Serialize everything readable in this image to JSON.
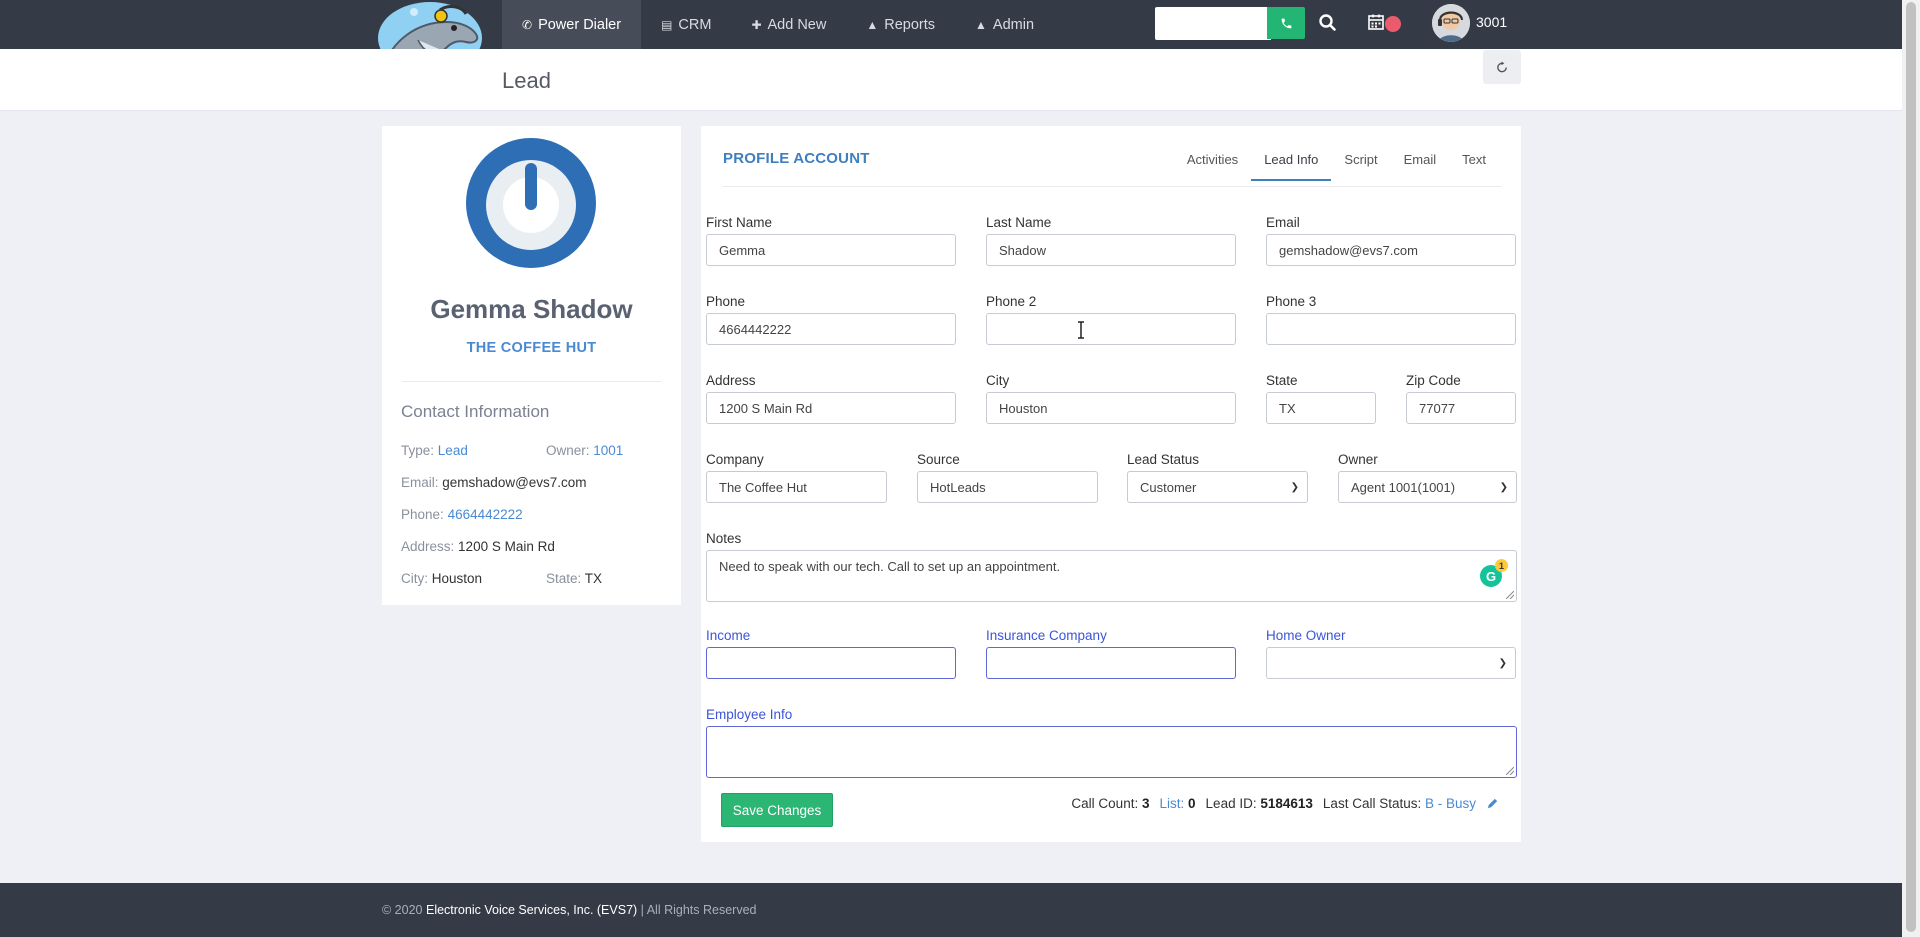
{
  "nav": {
    "items": [
      {
        "label": "Power Dialer",
        "icon": "phone-icon"
      },
      {
        "label": "CRM",
        "icon": "book-icon"
      },
      {
        "label": "Add New",
        "icon": "plus-icon"
      },
      {
        "label": "Reports",
        "icon": "flask-icon"
      },
      {
        "label": "Admin",
        "icon": "flask-icon"
      }
    ],
    "search_placeholder": "",
    "user_id": "3001"
  },
  "page": {
    "title": "Lead"
  },
  "profile": {
    "name": "Gemma Shadow",
    "company": "THE COFFEE HUT",
    "contact_title": "Contact Information",
    "type_label": "Type:",
    "type_value": "Lead",
    "owner_label": "Owner:",
    "owner_value": "1001",
    "email_label": "Email:",
    "email_value": "gemshadow@evs7.com",
    "phone_label": "Phone:",
    "phone_value": "4664442222",
    "address_label": "Address:",
    "address_value": "1200 S Main Rd",
    "city_label": "City:",
    "city_value": "Houston",
    "state_label": "State:",
    "state_value": "TX"
  },
  "main": {
    "heading": "PROFILE ACCOUNT",
    "tabs": [
      "Activities",
      "Lead Info",
      "Script",
      "Email",
      "Text"
    ],
    "active_tab": "Lead Info",
    "fields": {
      "first_name": {
        "label": "First Name",
        "value": "Gemma"
      },
      "last_name": {
        "label": "Last Name",
        "value": "Shadow"
      },
      "email": {
        "label": "Email",
        "value": "gemshadow@evs7.com"
      },
      "phone": {
        "label": "Phone",
        "value": "4664442222"
      },
      "phone2": {
        "label": "Phone 2",
        "value": ""
      },
      "phone3": {
        "label": "Phone 3",
        "value": ""
      },
      "address": {
        "label": "Address",
        "value": "1200 S Main Rd"
      },
      "city": {
        "label": "City",
        "value": "Houston"
      },
      "state": {
        "label": "State",
        "value": "TX"
      },
      "zip": {
        "label": "Zip Code",
        "value": "77077"
      },
      "company": {
        "label": "Company",
        "value": "The Coffee Hut"
      },
      "source": {
        "label": "Source",
        "value": "HotLeads"
      },
      "lead_status": {
        "label": "Lead Status",
        "value": "Customer"
      },
      "owner": {
        "label": "Owner",
        "value": "Agent 1001(1001)"
      },
      "notes": {
        "label": "Notes",
        "value": "Need to speak with our tech. Call to set up an appointment."
      },
      "income": {
        "label": "Income",
        "value": ""
      },
      "insurance": {
        "label": "Insurance Company",
        "value": ""
      },
      "home_owner": {
        "label": "Home Owner",
        "value": ""
      },
      "employee_info": {
        "label": "Employee Info",
        "value": ""
      }
    },
    "grammarly_count": "1",
    "save_label": "Save Changes",
    "stats": {
      "call_count_label": "Call Count:",
      "call_count": "3",
      "list_label": "List:",
      "list_value": "0",
      "lead_id_label": "Lead ID:",
      "lead_id": "5184613",
      "last_call_label": "Last Call Status:",
      "last_call_value": "B - Busy"
    }
  },
  "footer": {
    "prefix": "© 2020",
    "company": "Electronic Voice Services, Inc. (EVS7)",
    "suffix": "| All Rights Reserved"
  },
  "colors": {
    "topbar": "#353b46",
    "accent_green": "#2bb673",
    "accent_blue": "#3f7fbf",
    "link_blue": "#4a8ad4",
    "alert_red": "#ec5b6d"
  }
}
